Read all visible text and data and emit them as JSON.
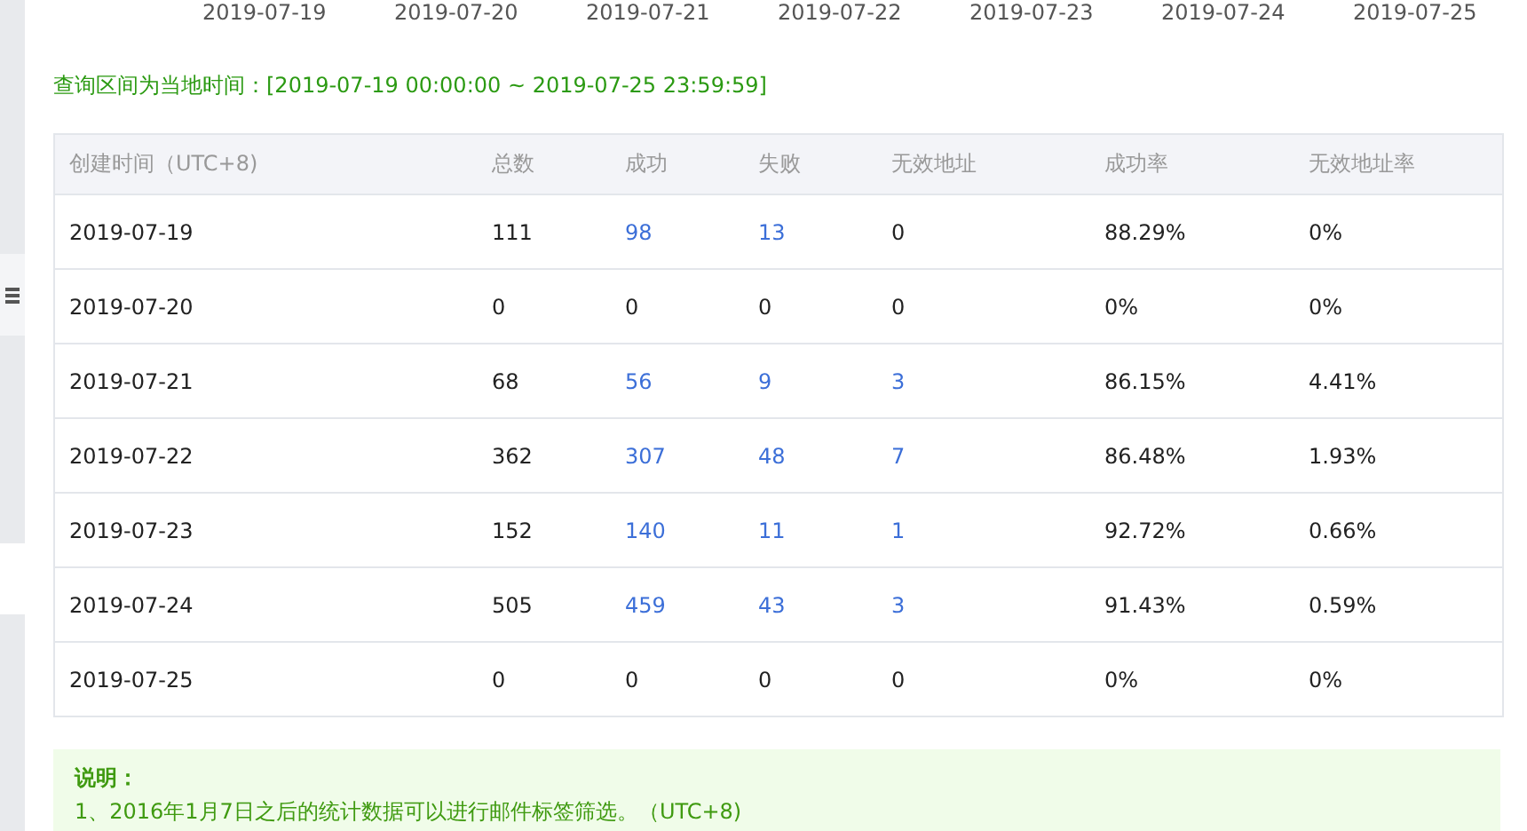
{
  "chart_axis_labels": [
    "2019-07-19",
    "2019-07-20",
    "2019-07-21",
    "2019-07-22",
    "2019-07-23",
    "2019-07-24",
    "2019-07-25"
  ],
  "query_range": "查询区间为当地时间：[2019-07-19 00:00:00 ~ 2019-07-25 23:59:59]",
  "table": {
    "columns": [
      "创建时间（UTC+8)",
      "总数",
      "成功",
      "失败",
      "无效地址",
      "成功率",
      "无效地址率"
    ],
    "rows": [
      [
        {
          "text": "2019-07-19",
          "link": false
        },
        {
          "text": "111",
          "link": false
        },
        {
          "text": "98",
          "link": true
        },
        {
          "text": "13",
          "link": true
        },
        {
          "text": "0",
          "link": false
        },
        {
          "text": "88.29%",
          "link": false
        },
        {
          "text": "0%",
          "link": false
        }
      ],
      [
        {
          "text": "2019-07-20",
          "link": false
        },
        {
          "text": "0",
          "link": false
        },
        {
          "text": "0",
          "link": false
        },
        {
          "text": "0",
          "link": false
        },
        {
          "text": "0",
          "link": false
        },
        {
          "text": "0%",
          "link": false
        },
        {
          "text": "0%",
          "link": false
        }
      ],
      [
        {
          "text": "2019-07-21",
          "link": false
        },
        {
          "text": "68",
          "link": false
        },
        {
          "text": "56",
          "link": true
        },
        {
          "text": "9",
          "link": true
        },
        {
          "text": "3",
          "link": true
        },
        {
          "text": "86.15%",
          "link": false
        },
        {
          "text": "4.41%",
          "link": false
        }
      ],
      [
        {
          "text": "2019-07-22",
          "link": false
        },
        {
          "text": "362",
          "link": false
        },
        {
          "text": "307",
          "link": true
        },
        {
          "text": "48",
          "link": true
        },
        {
          "text": "7",
          "link": true
        },
        {
          "text": "86.48%",
          "link": false
        },
        {
          "text": "1.93%",
          "link": false
        }
      ],
      [
        {
          "text": "2019-07-23",
          "link": false
        },
        {
          "text": "152",
          "link": false
        },
        {
          "text": "140",
          "link": true
        },
        {
          "text": "11",
          "link": true
        },
        {
          "text": "1",
          "link": true
        },
        {
          "text": "92.72%",
          "link": false
        },
        {
          "text": "0.66%",
          "link": false
        }
      ],
      [
        {
          "text": "2019-07-24",
          "link": false
        },
        {
          "text": "505",
          "link": false
        },
        {
          "text": "459",
          "link": true
        },
        {
          "text": "43",
          "link": true
        },
        {
          "text": "3",
          "link": true
        },
        {
          "text": "91.43%",
          "link": false
        },
        {
          "text": "0.59%",
          "link": false
        }
      ],
      [
        {
          "text": "2019-07-25",
          "link": false
        },
        {
          "text": "0",
          "link": false
        },
        {
          "text": "0",
          "link": false
        },
        {
          "text": "0",
          "link": false
        },
        {
          "text": "0",
          "link": false
        },
        {
          "text": "0%",
          "link": false
        },
        {
          "text": "0%",
          "link": false
        }
      ]
    ]
  },
  "notice": {
    "title": "说明：",
    "lines": [
      "1、2016年1月7日之后的统计数据可以进行邮件标签筛选。（UTC+8)"
    ]
  }
}
